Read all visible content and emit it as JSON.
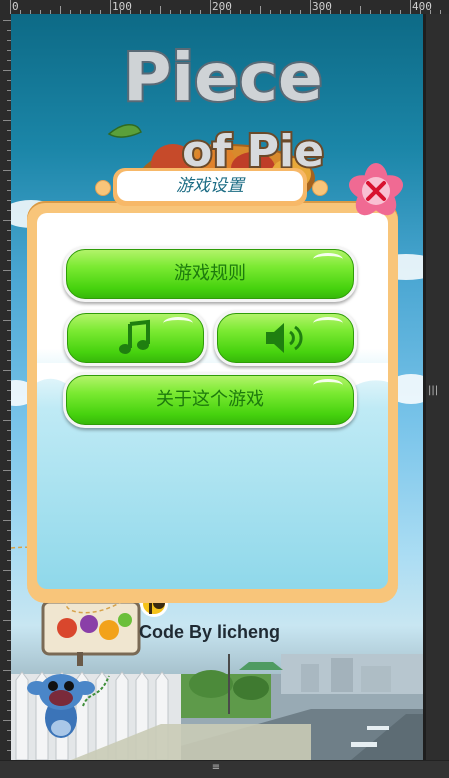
{
  "ruler": {
    "labels": [
      "0",
      "100",
      "200",
      "300",
      "400"
    ]
  },
  "logo": {
    "line1": "Piece",
    "line2": "of Pie"
  },
  "dialog": {
    "title": "游戏设置",
    "rules_button": "游戏规则",
    "music_icon": "music-note-icon",
    "sound_icon": "speaker-icon",
    "about_button": "关于这个游戏",
    "close_icon": "close-icon"
  },
  "footer": {
    "credit": "Code By licheng"
  },
  "colors": {
    "panel_border": "#f8c57a",
    "button_green": "#46d20e",
    "button_text": "#1d7a0d",
    "title_text": "#1c6c84",
    "close_pink": "#ef5f8c"
  }
}
